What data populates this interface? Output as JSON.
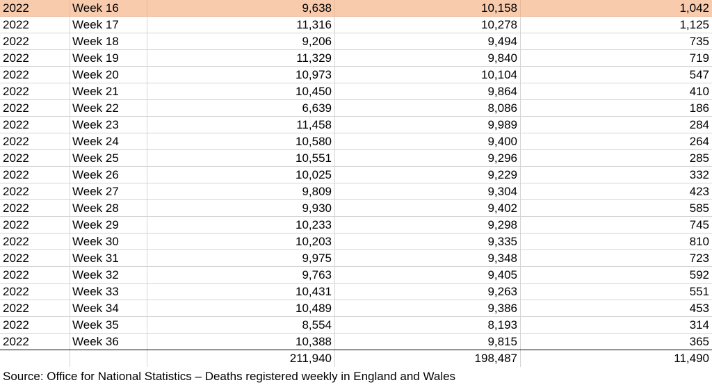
{
  "table": {
    "rows": [
      {
        "year": "2022",
        "week": "Week 16",
        "a": "9,638",
        "b": "10,158",
        "c": "1,042",
        "highlight": true
      },
      {
        "year": "2022",
        "week": "Week 17",
        "a": "11,316",
        "b": "10,278",
        "c": "1,125"
      },
      {
        "year": "2022",
        "week": "Week 18",
        "a": "9,206",
        "b": "9,494",
        "c": "735"
      },
      {
        "year": "2022",
        "week": "Week 19",
        "a": "11,329",
        "b": "9,840",
        "c": "719"
      },
      {
        "year": "2022",
        "week": "Week 20",
        "a": "10,973",
        "b": "10,104",
        "c": "547"
      },
      {
        "year": "2022",
        "week": "Week 21",
        "a": "10,450",
        "b": "9,864",
        "c": "410"
      },
      {
        "year": "2022",
        "week": "Week 22",
        "a": "6,639",
        "b": "8,086",
        "c": "186"
      },
      {
        "year": "2022",
        "week": "Week 23",
        "a": "11,458",
        "b": "9,989",
        "c": "284"
      },
      {
        "year": "2022",
        "week": "Week 24",
        "a": "10,580",
        "b": "9,400",
        "c": "264"
      },
      {
        "year": "2022",
        "week": "Week 25",
        "a": "10,551",
        "b": "9,296",
        "c": "285"
      },
      {
        "year": "2022",
        "week": "Week 26",
        "a": "10,025",
        "b": "9,229",
        "c": "332"
      },
      {
        "year": "2022",
        "week": "Week 27",
        "a": "9,809",
        "b": "9,304",
        "c": "423"
      },
      {
        "year": "2022",
        "week": "Week 28",
        "a": "9,930",
        "b": "9,402",
        "c": "585"
      },
      {
        "year": "2022",
        "week": "Week 29",
        "a": "10,233",
        "b": "9,298",
        "c": "745"
      },
      {
        "year": "2022",
        "week": "Week 30",
        "a": "10,203",
        "b": "9,335",
        "c": "810"
      },
      {
        "year": "2022",
        "week": "Week 31",
        "a": "9,975",
        "b": "9,348",
        "c": "723"
      },
      {
        "year": "2022",
        "week": "Week 32",
        "a": "9,763",
        "b": "9,405",
        "c": "592"
      },
      {
        "year": "2022",
        "week": "Week 33",
        "a": "10,431",
        "b": "9,263",
        "c": "551"
      },
      {
        "year": "2022",
        "week": "Week 34",
        "a": "10,489",
        "b": "9,386",
        "c": "453"
      },
      {
        "year": "2022",
        "week": "Week 35",
        "a": "8,554",
        "b": "8,193",
        "c": "314"
      },
      {
        "year": "2022",
        "week": "Week 36",
        "a": "10,388",
        "b": "9,815",
        "c": "365"
      }
    ],
    "totals": {
      "a": "211,940",
      "b": "198,487",
      "c": "11,490"
    }
  },
  "source_note": "Source: Office for National Statistics – Deaths registered weekly in England and Wales",
  "colors": {
    "highlight_row": "#f8cbad",
    "gridline": "#d4d4d4"
  }
}
